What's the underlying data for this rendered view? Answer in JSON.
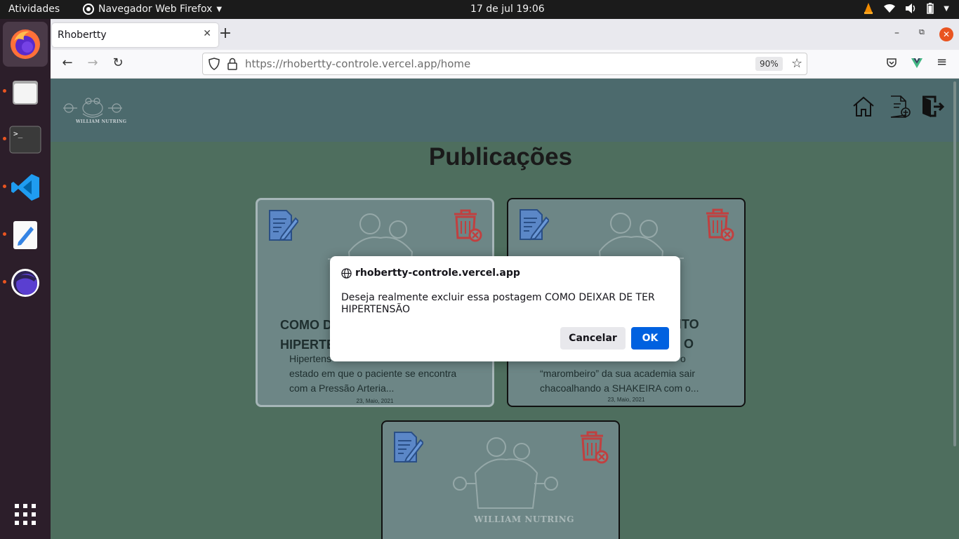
{
  "topbar": {
    "activities": "Atividades",
    "app_name": "Navegador Web Firefox",
    "clock": "17 de jul  19:06"
  },
  "dock": {
    "items": [
      "firefox-icon",
      "files-icon",
      "terminal-icon",
      "vscode-icon",
      "text-editor-icon",
      "eclipse-icon",
      "app-grid-icon"
    ]
  },
  "browser": {
    "tab_title": "Rhobertty",
    "url_host": "https://rhobertty-controle.vercel.app",
    "url_path": "/home",
    "zoom": "90%"
  },
  "page": {
    "logo_text": "WILLIAM NUTRING",
    "title": "Publicações",
    "cards": [
      {
        "title": "COMO DEIXAR DE TER HIPERTENSÃO",
        "title_visible": "COMO D\nHIPERTE",
        "excerpt": "Hipertens…, estado em que o paciente se encontra com a Pressão Arteria...",
        "excerpt_line1": "Hipertens",
        "excerpt_line2": "estado em que o paciente se encontra",
        "excerpt_line3": "com a Pressão Arteria...",
        "date": "23, Maio, 2021"
      },
      {
        "title_line1": "NTO",
        "title_line2": "O",
        "excerpt_line1": "o",
        "excerpt_line2": "“marombeiro” da sua academia sair",
        "excerpt_line3": "chacoalhando a SHAKEIRA com o...",
        "date": "23, Maio, 2021"
      },
      {
        "watermark": "WILLIAM NUTRING"
      }
    ]
  },
  "dialog": {
    "origin": "rhobertty-controle.vercel.app",
    "message": "Deseja realmente excluir essa postagem COMO DEIXAR DE TER HIPERTENSÃO",
    "cancel_label": "Cancelar",
    "ok_label": "OK"
  }
}
